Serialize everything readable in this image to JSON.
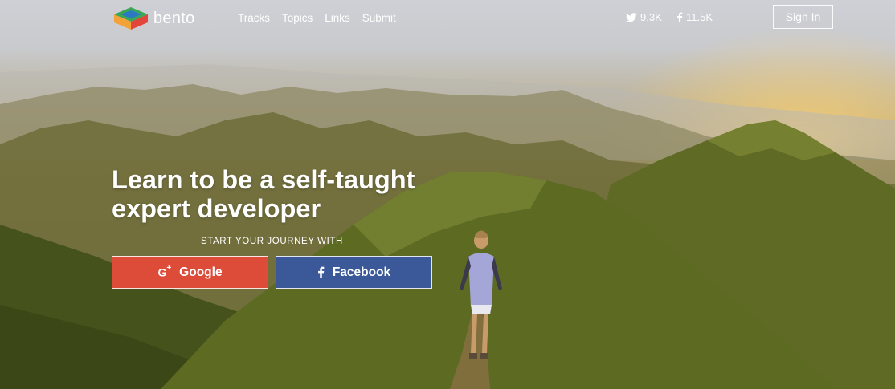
{
  "brand": {
    "name": "bento"
  },
  "nav": {
    "links": [
      {
        "label": "Tracks"
      },
      {
        "label": "Topics"
      },
      {
        "label": "Links"
      },
      {
        "label": "Submit"
      }
    ],
    "social": {
      "twitter_count": "9.3K",
      "facebook_count": "11.5K"
    },
    "signin_label": "Sign In"
  },
  "hero": {
    "headline_line1": "Learn to be a self-taught",
    "headline_line2": "expert developer",
    "tagline": "START YOUR JOURNEY WITH",
    "google_label": "Google",
    "facebook_label": "Facebook"
  },
  "colors": {
    "google_button": "#dd4b39",
    "facebook_button": "#3b5998",
    "logo_green": "#3aa757",
    "logo_blue": "#2b78c5",
    "logo_orange": "#f3a23a",
    "logo_red": "#e2453c"
  },
  "icons": [
    "bento-logo-icon",
    "twitter-icon",
    "facebook-icon",
    "google-plus-icon",
    "facebook-f-icon"
  ]
}
